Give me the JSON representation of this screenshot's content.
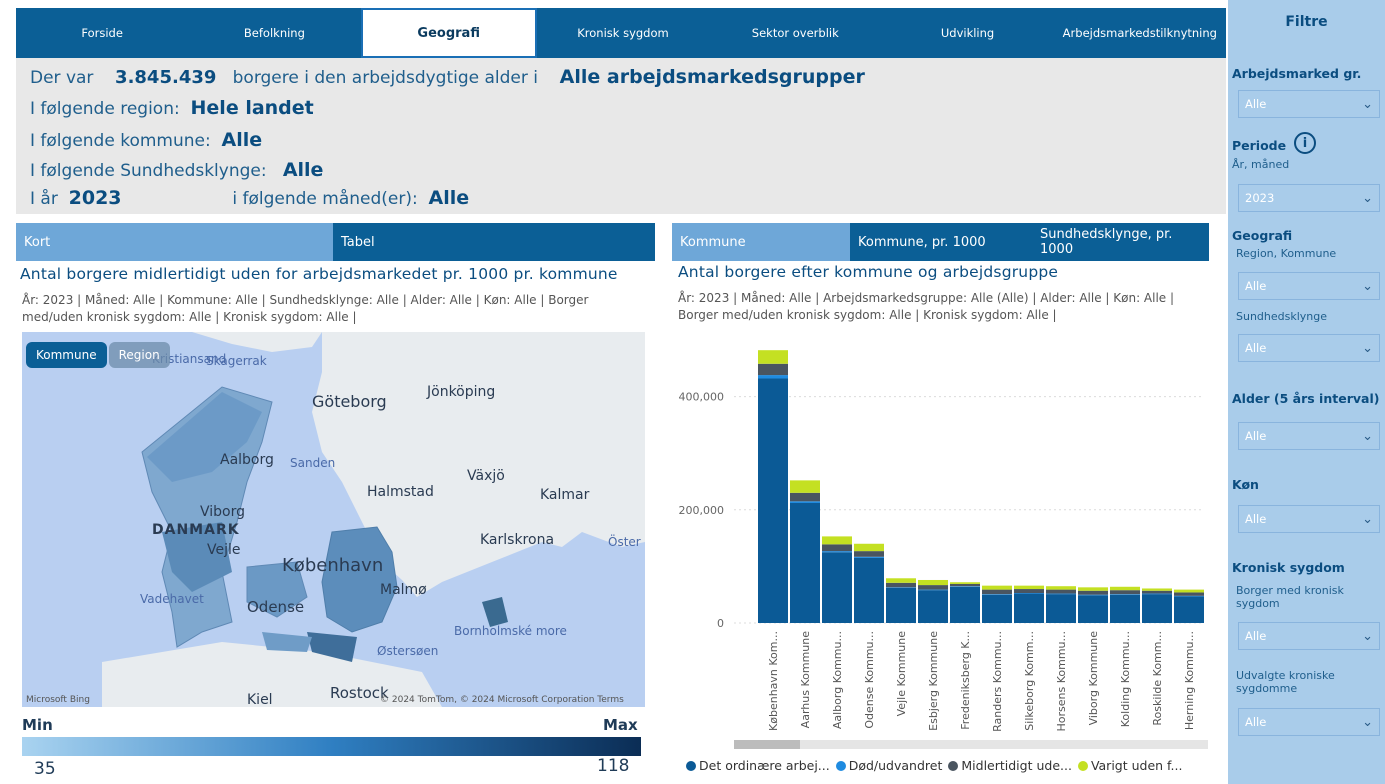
{
  "nav": {
    "tabs": [
      {
        "label": "Forside"
      },
      {
        "label": "Befolkning"
      },
      {
        "label": "Geografi",
        "active": true
      },
      {
        "label": "Kronisk sygdom"
      },
      {
        "label": "Sektor overblik"
      },
      {
        "label": "Udvikling"
      },
      {
        "label": "Arbejdsmarkedstilknytning"
      }
    ]
  },
  "summary": {
    "l1_prefix": "Der var",
    "l1_count": "3.845.439",
    "l1_mid": "borgere i den arbejdsdygtige alder i",
    "l1_group": "Alle arbejdsmarkedsgrupper",
    "l2_prefix": "I følgende region:",
    "l2_value": "Hele landet",
    "l3_prefix": "I følgende kommune:",
    "l3_value": "Alle",
    "l4_prefix": "I følgende Sundhedsklynge:",
    "l4_value": "Alle",
    "l5_prefix": "I år",
    "l5_year": "2023",
    "l5_mid": "i følgende måned(er):",
    "l5_value": "Alle"
  },
  "left": {
    "tabs": [
      "Kort",
      "Tabel"
    ],
    "title": "Antal borgere midlertidigt uden for arbejdsmarkedet pr. 1000 pr. kommune",
    "subtitle": "År: 2023 | Måned: Alle | Kommune: Alle | Sundhedsklynge: Alle | Alder: Alle | Køn: Alle | Borger med/uden kronisk sygdom: Alle | Kronisk sygdom: Alle |",
    "map_buttons": [
      "Kommune",
      "Region"
    ],
    "map_labels": {
      "skagerrak": "Skagerrak",
      "kristiansand": "Kristiansand",
      "goteborg": "Göteborg",
      "jonkoping": "Jönköping",
      "aalborg": "Aalborg",
      "sanden": "Sanden",
      "vaxjo": "Växjö",
      "halmstad": "Halmstad",
      "kalmar": "Kalmar",
      "viborg": "Viborg",
      "danmark": "DANMARK",
      "karlskrona": "Karlskrona",
      "oster": "Öster",
      "kobenhavn": "København",
      "vejle": "Vejle",
      "malmo": "Malmø",
      "vadehavet": "Vadehavet",
      "odense": "Odense",
      "bornholm": "Bornholmské more",
      "ostersoen": "Østersøen",
      "kiel": "Kiel",
      "rostock": "Rostock",
      "attrib_left": "Microsoft Bing",
      "attrib_right": "© 2024 TomTom, © 2024 Microsoft Corporation  Terms"
    },
    "legend": {
      "min_label": "Min",
      "max_label": "Max",
      "min_value": "35",
      "max_value": "118"
    }
  },
  "right": {
    "tabs": [
      "Kommune",
      "Kommune, pr. 1000",
      "Sundhedsklynge, pr. 1000"
    ],
    "title": "Antal borgere efter kommune og arbejdsgruppe",
    "subtitle": "År: 2023 | Måned: Alle | Arbejdsmarkedsgruppe: Alle (Alle) | Alder: Alle | Køn: Alle | Borger med/uden kronisk sygdom: Alle | Kronisk sygdom: Alle |"
  },
  "chart_data": {
    "type": "bar",
    "stacked": true,
    "categories": [
      "København Kom...",
      "Aarhus Kommune",
      "Aalborg Kommu...",
      "Odense Kommu...",
      "Vejle Kommune",
      "Esbjerg Kommune",
      "Fredeniksberg K...",
      "Randers Kommu...",
      "Silkeborg Komm...",
      "Horsens Kommu...",
      "Viborg Kommune",
      "Kolding Kommu...",
      "Roskilde Komm...",
      "Herning Kommu..."
    ],
    "series": [
      {
        "name": "Det ordinære arbej...",
        "color": "#0b5a96",
        "values": [
          432000,
          212000,
          125000,
          115000,
          62000,
          58000,
          64000,
          50000,
          52000,
          51000,
          49000,
          50000,
          51000,
          47000
        ]
      },
      {
        "name": "Død/udvandret",
        "color": "#1f8be0",
        "values": [
          6000,
          3000,
          2000,
          2000,
          1000,
          1000,
          1000,
          1000,
          1000,
          1000,
          1000,
          1000,
          1000,
          1000
        ]
      },
      {
        "name": "Midlertidigt ude...",
        "color": "#4a5560",
        "values": [
          20000,
          15000,
          12000,
          10000,
          8000,
          8000,
          4000,
          8000,
          7000,
          7000,
          7000,
          7000,
          5000,
          6000
        ]
      },
      {
        "name": "Varigt uden f...",
        "color": "#c4e022",
        "values": [
          24000,
          22000,
          14000,
          13000,
          8000,
          9000,
          3000,
          7000,
          6000,
          6000,
          6000,
          6000,
          4000,
          5000
        ]
      }
    ],
    "y_ticks": [
      "0",
      "200,000",
      "400,000"
    ],
    "ylim": [
      0,
      500000
    ],
    "grid": true,
    "legend_position": "bottom"
  },
  "filters": {
    "title": "Filtre",
    "arbejdsmarked_label": "Arbejdsmarked gr.",
    "arbejdsmarked_value": "Alle",
    "periode_label": "Periode",
    "periode_sub": "År, måned",
    "periode_value": "2023",
    "geografi_label": "Geografi",
    "geografi_sub": "Region, Kommune",
    "geografi_value": "Alle",
    "sundhed_sub": "Sundhedsklynge",
    "sundhed_value": "Alle",
    "alder_label": "Alder (5 års interval)",
    "alder_value": "Alle",
    "kon_label": "Køn",
    "kon_value": "Alle",
    "kronisk_label": "Kronisk sygdom",
    "kronisk_sub": "Borger med kronisk sygdom",
    "kronisk_value": "Alle",
    "udvalgte_sub": "Udvalgte kroniske sygdomme",
    "udvalgte_value": "Alle"
  }
}
